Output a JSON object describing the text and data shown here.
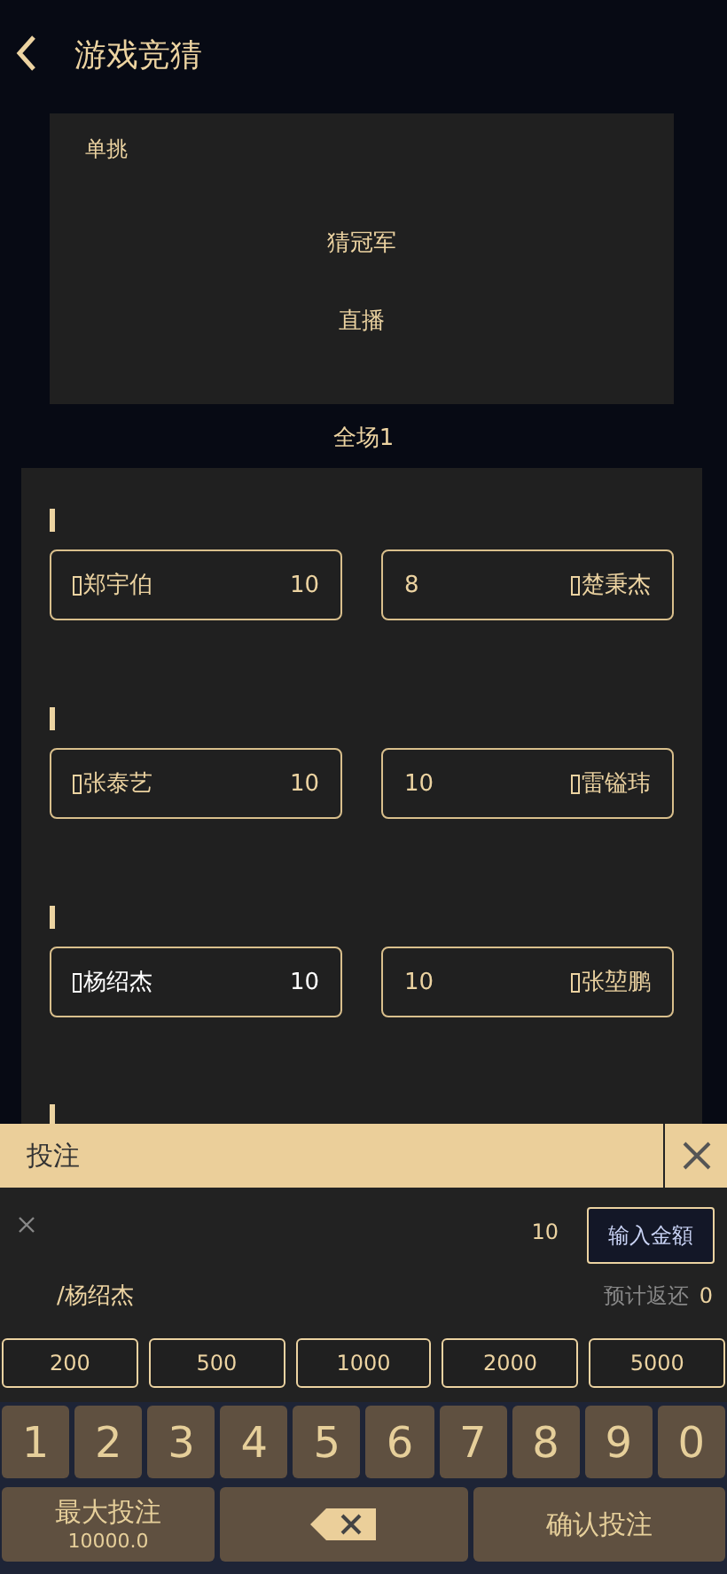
{
  "header": {
    "title": "游戏竞猜"
  },
  "card": {
    "tag": "单挑",
    "title": "猜冠军",
    "live": "直播"
  },
  "round_label": "全场1",
  "matches": [
    {
      "kind": "pair",
      "left": {
        "name": "郑宇伯",
        "odds": "10",
        "selected": false
      },
      "right": {
        "name": "楚秉杰",
        "odds": "8",
        "selected": false
      }
    },
    {
      "kind": "pair",
      "left": {
        "name": "张泰艺",
        "odds": "10",
        "selected": false
      },
      "right": {
        "name": "雷镒玮",
        "odds": "10",
        "selected": false
      }
    },
    {
      "kind": "pair",
      "left": {
        "name": "杨绍杰",
        "odds": "10",
        "selected": true
      },
      "right": {
        "name": "张堃鹏",
        "odds": "10",
        "selected": false
      }
    },
    {
      "kind": "marker_only"
    }
  ],
  "bet_sheet": {
    "title": "投注",
    "amount": "10",
    "input_button": "输入金額",
    "pick": "/杨绍杰",
    "return_label": "预计返还",
    "return_value": "0",
    "chips": [
      "200",
      "500",
      "1000",
      "2000",
      "5000"
    ],
    "digits": [
      "1",
      "2",
      "3",
      "4",
      "5",
      "6",
      "7",
      "8",
      "9",
      "0"
    ],
    "max_label": "最大投注",
    "max_value": "10000.0",
    "confirm": "确认投注"
  }
}
